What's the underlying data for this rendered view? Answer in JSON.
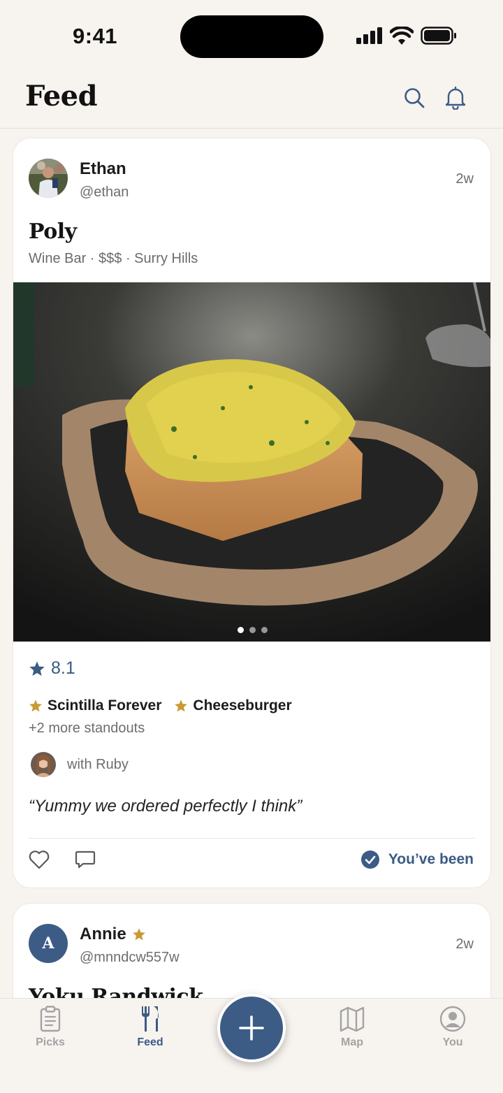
{
  "status_bar": {
    "time": "9:41"
  },
  "header": {
    "title": "Feed"
  },
  "posts": [
    {
      "user": {
        "name": "Ethan",
        "handle": "@ethan"
      },
      "time": "2w",
      "place": {
        "name": "Poly",
        "meta": "Wine Bar · $$$ · Surry Hills"
      },
      "photo_pages": 3,
      "rating": "8.1",
      "standouts": [
        "Scintilla Forever",
        "Cheeseburger"
      ],
      "more_standouts": "+2 more standouts",
      "with": "with Ruby",
      "quote": "“Yummy we ordered perfectly I think”",
      "been_label": "You’ve been"
    },
    {
      "user": {
        "name": "Annie",
        "handle": "@mnndcw557w",
        "initial": "A"
      },
      "time": "2w",
      "place": {
        "name": "Yoku Randwick"
      }
    }
  ],
  "tabbar": {
    "tabs": [
      {
        "label": "Picks",
        "icon": "clipboard-icon"
      },
      {
        "label": "Feed",
        "icon": "fork-knife-icon"
      },
      {
        "label": "Map",
        "icon": "map-icon"
      },
      {
        "label": "You",
        "icon": "person-icon"
      }
    ],
    "active": "Feed"
  },
  "colors": {
    "accent": "#3d5c85",
    "star_gold": "#c99a35",
    "background": "#f7f3ef"
  }
}
